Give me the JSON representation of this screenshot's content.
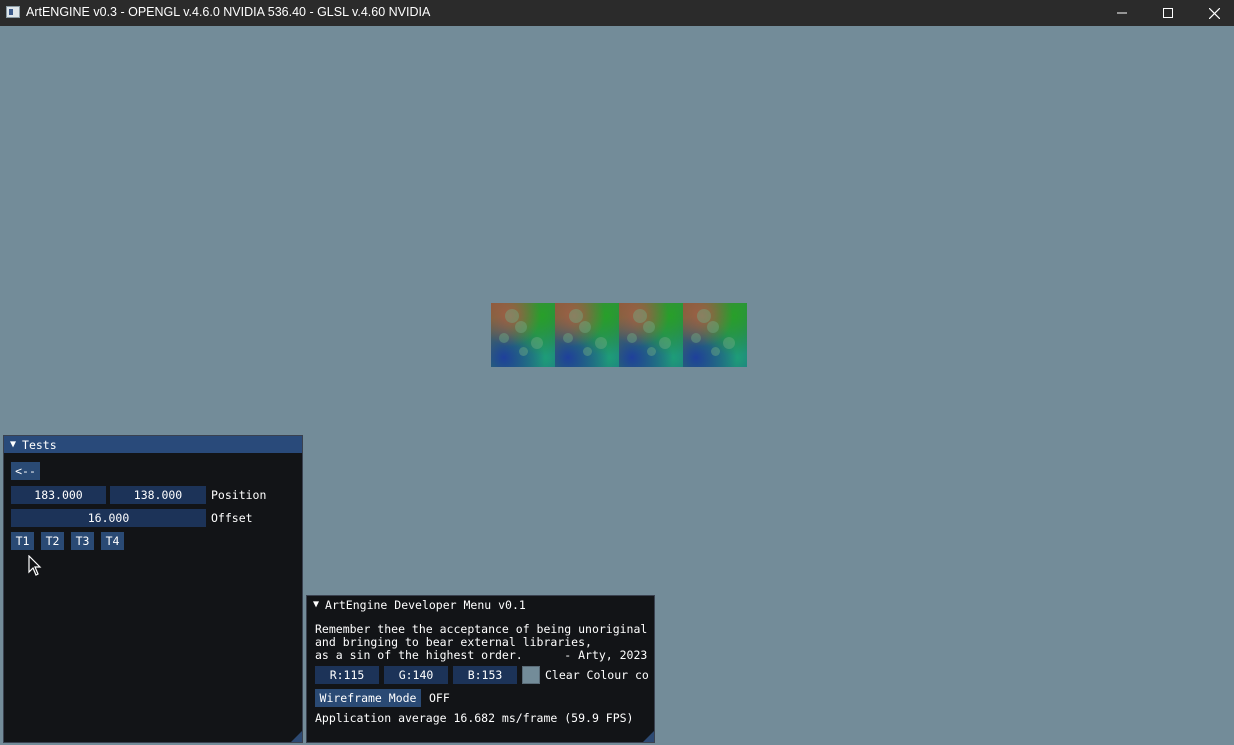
{
  "window": {
    "title": "ArtENGINE v0.3 - OPENGL v.4.6.0 NVIDIA 536.40 - GLSL v.4.60 NVIDIA"
  },
  "scene": {
    "clear_color": "#738c99",
    "tile_count": 4
  },
  "tests_panel": {
    "header": "Tests",
    "back_button": "<--",
    "position_x": "183.000",
    "position_y": "138.000",
    "position_label": "Position",
    "offset_value": "16.000",
    "offset_label": "Offset",
    "test_buttons": [
      "T1",
      "T2",
      "T3",
      "T4"
    ]
  },
  "dev_menu": {
    "header": "ArtEngine Developer Menu v0.1",
    "quote": "Remember thee the acceptance of being unoriginal\nand bringing to bear external libraries,\nas a sin of the highest order.      - Arty, 2023",
    "color_r": "R:115",
    "color_g": "G:140",
    "color_b": "B:153",
    "clear_colour_label": "Clear Colour co",
    "wireframe_button": "Wireframe Mode",
    "wireframe_state": "OFF",
    "perf_text": "Application average 16.682 ms/frame (59.9 FPS)"
  },
  "icons": {
    "app": "artengine-app-icon",
    "minimize": "minimize-icon",
    "maximize": "maximize-icon",
    "close": "close-icon",
    "collapse": "collapse-arrow-icon",
    "cursor": "mouse-cursor-icon"
  }
}
